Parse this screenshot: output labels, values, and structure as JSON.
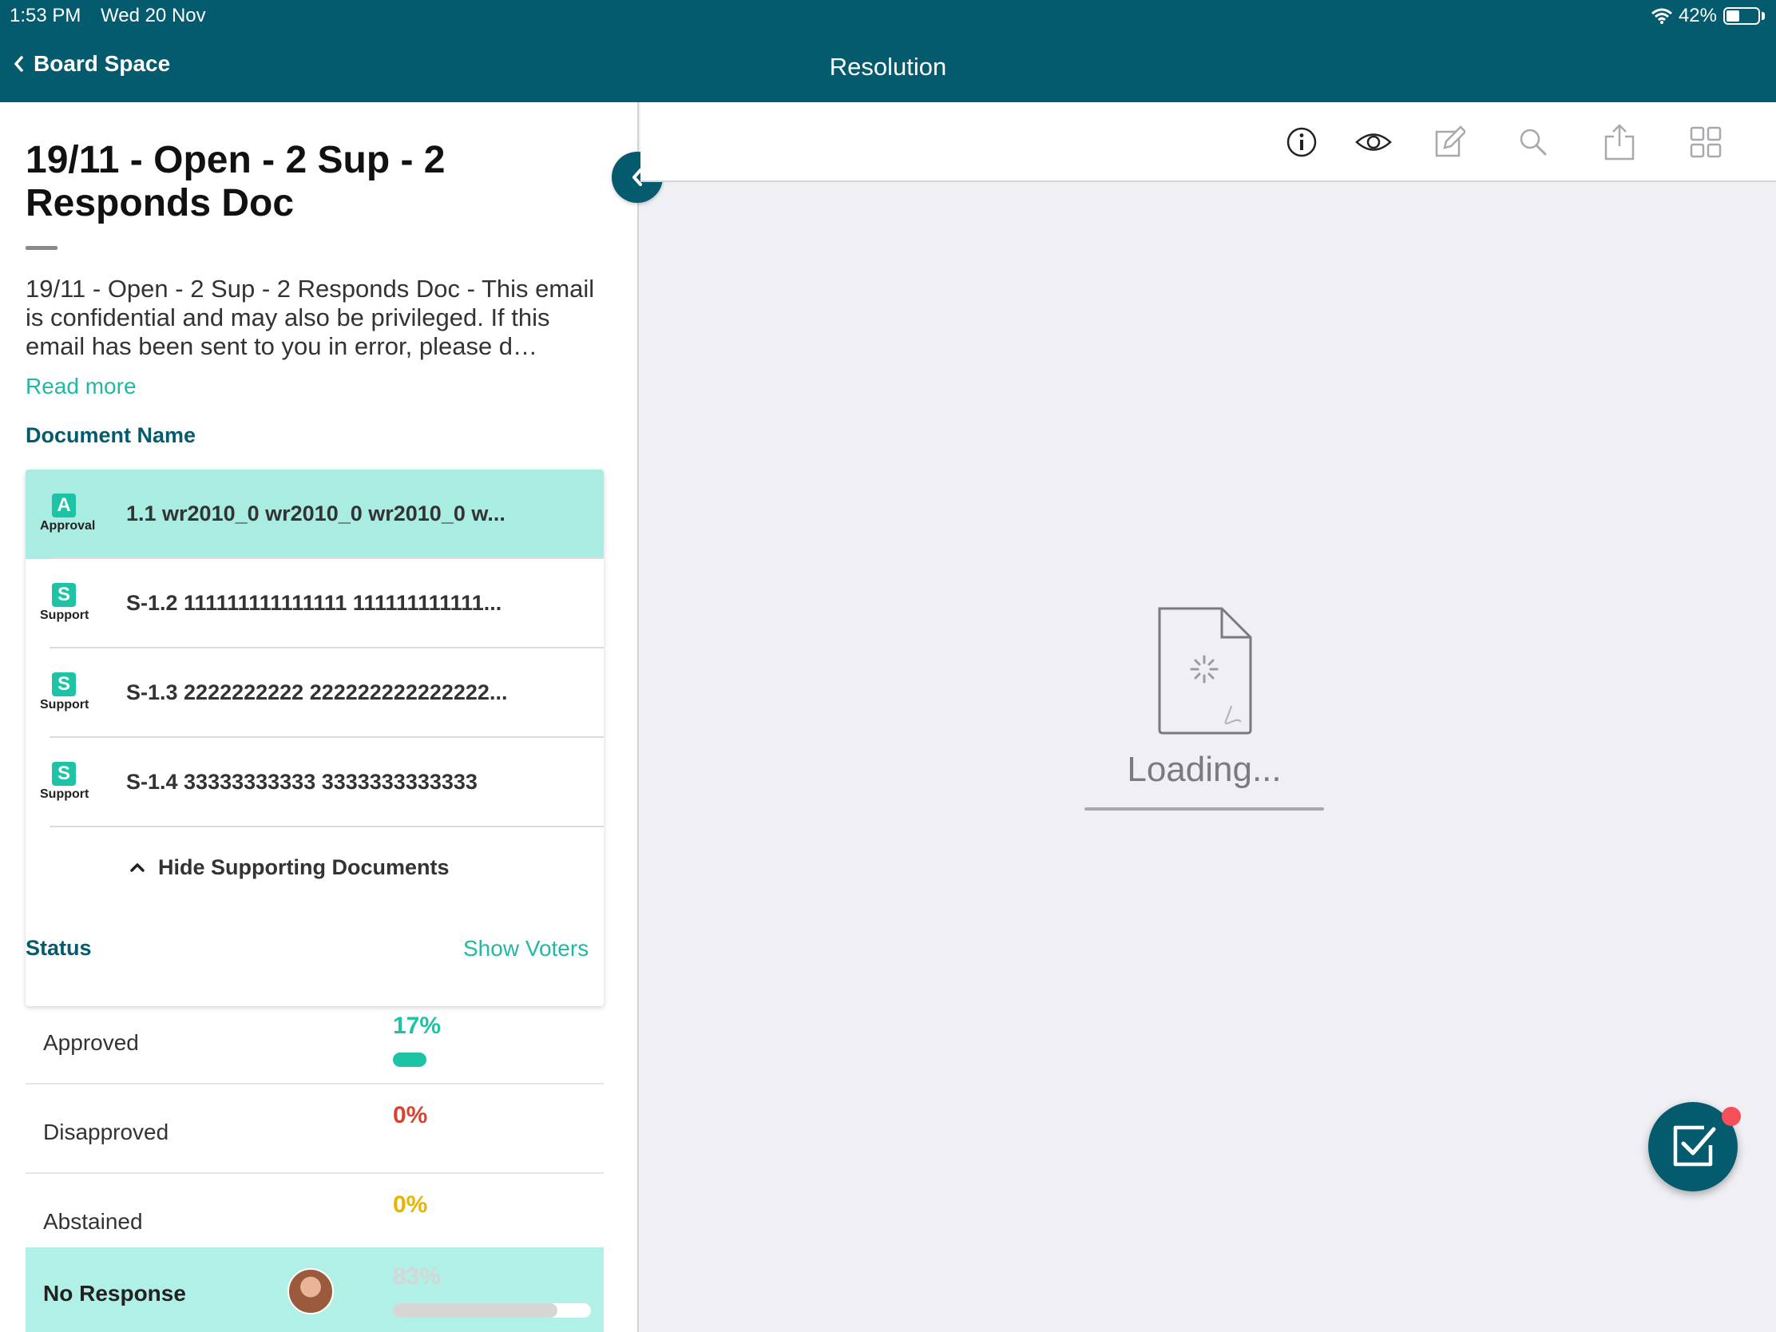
{
  "status_bar": {
    "time": "1:53 PM",
    "date": "Wed 20 Nov",
    "battery": "42%",
    "battery_level": 0.42
  },
  "nav": {
    "back_label": "Board Space",
    "title": "Resolution"
  },
  "resolution": {
    "title": "19/11 - Open - 2 Sup - 2 Responds Doc",
    "description": "19/11 - Open - 2 Sup - 2 Responds Doc  - This email is confidential and may also be privileged. If this email has been sent to you in error, please d…",
    "read_more": "Read more"
  },
  "documents": {
    "section_label": "Document Name",
    "items": [
      {
        "badge": "A",
        "type": "Approval",
        "name": "1.1 wr2010_0 wr2010_0 wr2010_0 w..."
      },
      {
        "badge": "S",
        "type": "Support",
        "name": "S-1.2 111111111111111 111111111111..."
      },
      {
        "badge": "S",
        "type": "Support",
        "name": "S-1.3 2222222222 222222222222222..."
      },
      {
        "badge": "S",
        "type": "Support",
        "name": "S-1.4 33333333333 3333333333333"
      }
    ],
    "hide_label": "Hide Supporting Documents"
  },
  "status": {
    "section_label": "Status",
    "show_voters": "Show Voters",
    "rows": [
      {
        "label": "Approved",
        "percent": "17%",
        "fraction": 0.17,
        "color": "#1cc3a4"
      },
      {
        "label": "Disapproved",
        "percent": "0%",
        "fraction": 0,
        "color": "#d9432f"
      },
      {
        "label": "Abstained",
        "percent": "0%",
        "fraction": 0,
        "color": "#e9b400"
      },
      {
        "label": "No Response",
        "percent": "83%",
        "fraction": 0.83,
        "color": "#d6d6d6"
      }
    ]
  },
  "viewer": {
    "loading_text": "Loading..."
  },
  "icons": {
    "back": "chevron-left-icon",
    "collapse": "chevron-left-icon",
    "toolbar": [
      "info-icon",
      "eye-icon",
      "edit-icon",
      "search-icon",
      "share-icon",
      "grid-icon"
    ],
    "fab": "checkbox-icon"
  },
  "colors": {
    "brand": "#045b6e",
    "accent": "#22b8a4",
    "selected_row": "#a8ece2"
  }
}
